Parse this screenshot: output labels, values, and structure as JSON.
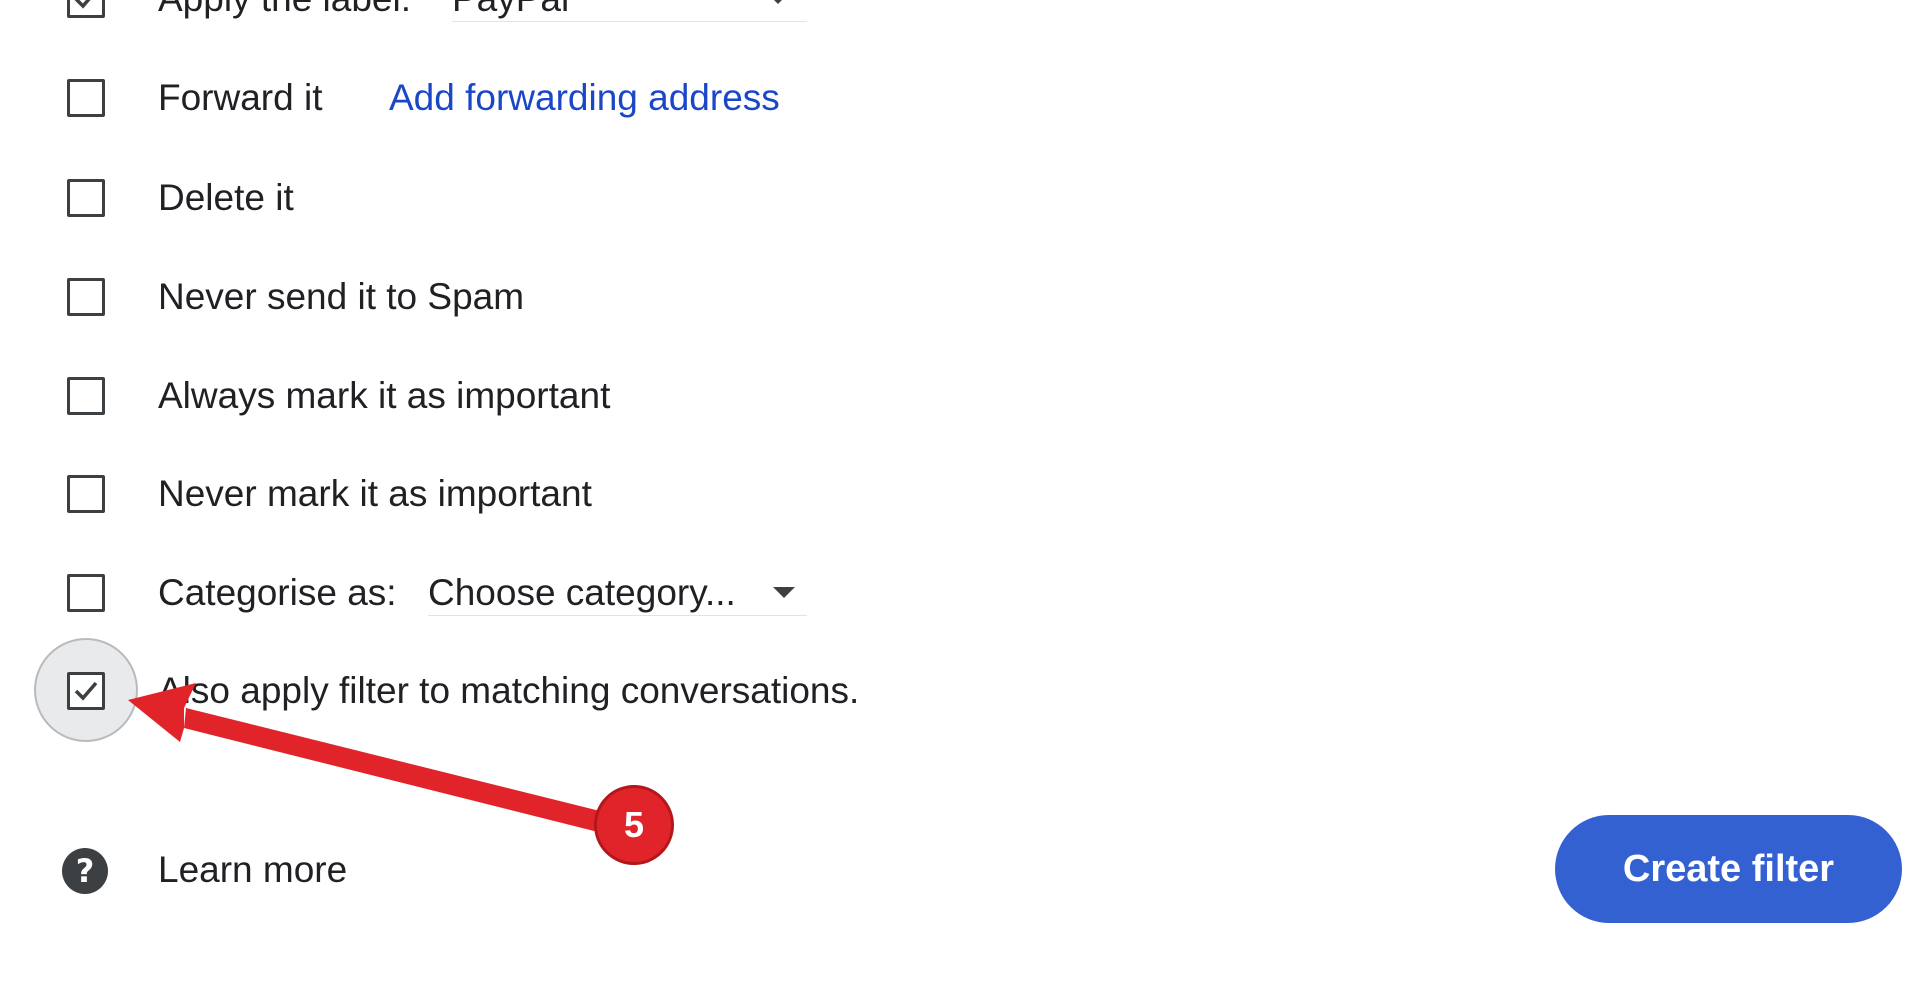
{
  "filter_actions": {
    "apply_label": {
      "label": "Apply the label:",
      "checked": true,
      "selected_value": "PayPal"
    },
    "forward": {
      "label": "Forward it",
      "checked": false,
      "link_text": "Add forwarding address"
    },
    "delete": {
      "label": "Delete it",
      "checked": false
    },
    "never_spam": {
      "label": "Never send it to Spam",
      "checked": false
    },
    "always_important": {
      "label": "Always mark it as important",
      "checked": false
    },
    "never_important": {
      "label": "Never mark it as important",
      "checked": false
    },
    "categorise": {
      "label": "Categorise as:",
      "checked": false,
      "selected_value": "Choose category..."
    },
    "also_apply": {
      "label": "Also apply filter to matching conversations.",
      "checked": true
    }
  },
  "footer": {
    "help_icon_name": "help-circle-icon",
    "help_glyph": "?",
    "learn_more": "Learn more",
    "create_filter": "Create filter"
  },
  "annotation": {
    "step_number": "5",
    "arrow_color": "#e0242a"
  },
  "colors": {
    "link": "#1a47c7",
    "primary_button": "#3461d1",
    "text": "#202124"
  }
}
